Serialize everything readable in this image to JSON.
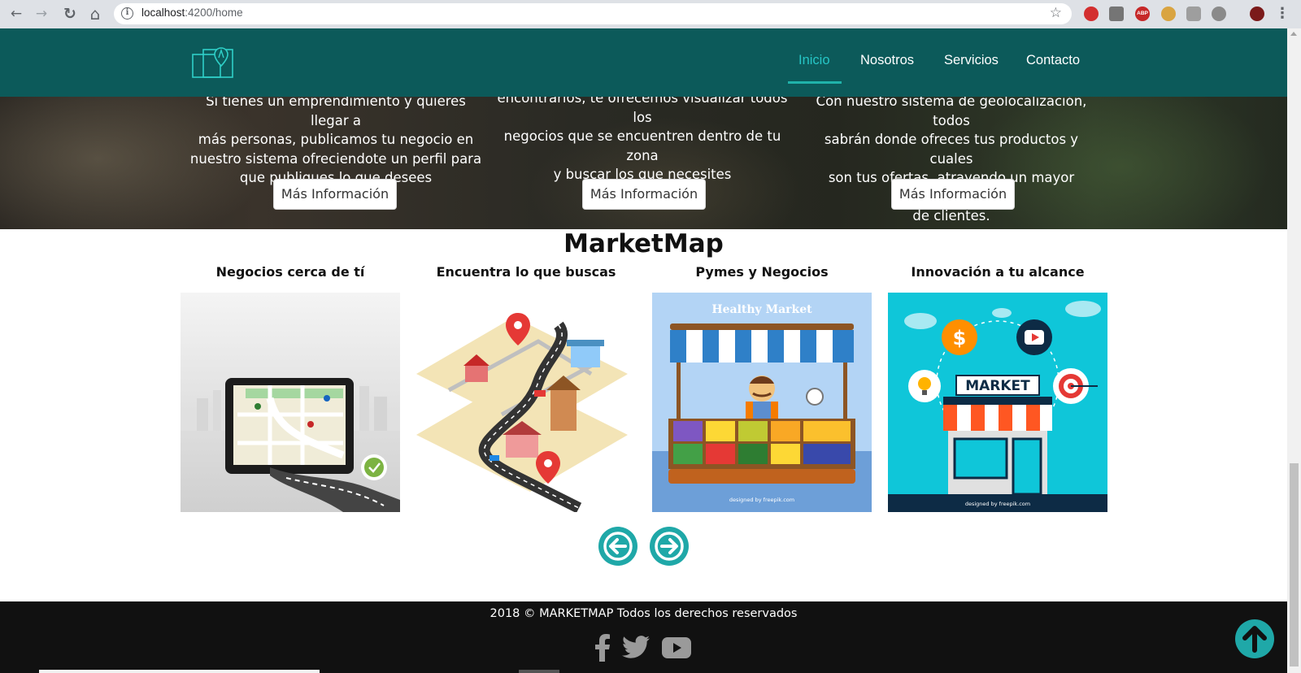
{
  "browser": {
    "url_host": "localhost",
    "url_rest": ":4200/home",
    "back_glyph": "←",
    "forward_glyph": "→",
    "reload_glyph": "↻",
    "home_glyph": "⌂",
    "info_glyph": "i",
    "star_glyph": "☆",
    "menu_glyph": "⋮",
    "abp_label": "ABP"
  },
  "navbar": {
    "background": "#0c5a5a",
    "accent": "#26c6c6",
    "links": [
      {
        "label": "Inicio",
        "active": true
      },
      {
        "label": "Nosotros",
        "active": false
      },
      {
        "label": "Servicios",
        "active": false
      },
      {
        "label": "Contacto",
        "active": false
      }
    ]
  },
  "hero": {
    "features": [
      {
        "lines": [
          "Si tienes un emprendimiento y quieres llegar a",
          "más personas, publicamos tu negocio en",
          "nuestro sistema ofreciendote un perfil para",
          "que publiques lo que desees"
        ]
      },
      {
        "lines": [
          "encontrarlos, te ofrecemos visualizar todos los",
          "negocios que se encuentren dentro de tu zona",
          "y buscar los que necesites"
        ]
      },
      {
        "lines": [
          "Con nuestro sistema de geolocalización, todos",
          "sabrán donde ofreces tus productos y cuales",
          "son tus ofertas, atrayendo un mayor numero",
          "de clientes."
        ]
      }
    ],
    "more_label": "Más Información"
  },
  "main": {
    "title": "MarketMap",
    "cards": [
      {
        "title": "Negocios cerca de tí",
        "image": "tablet-map-image"
      },
      {
        "title": "Encuentra lo que buscas",
        "image": "isometric-city-map-image"
      },
      {
        "title": "Pymes y Negocios",
        "image": "healthy-market-image",
        "sign": "Healthy Market",
        "credit": "designed by freepik.com"
      },
      {
        "title": "Innovación a tu alcance",
        "image": "market-store-image",
        "sign": "MARKET",
        "credit": "designed by freepik.com"
      }
    ],
    "prev_icon": "arrow-left-icon",
    "next_icon": "arrow-right-icon",
    "accent": "#1fa8a8"
  },
  "footer": {
    "copyright": "2018 © MARKETMAP Todos los derechos reservados",
    "social": [
      "facebook-icon",
      "twitter-icon",
      "youtube-icon"
    ]
  }
}
